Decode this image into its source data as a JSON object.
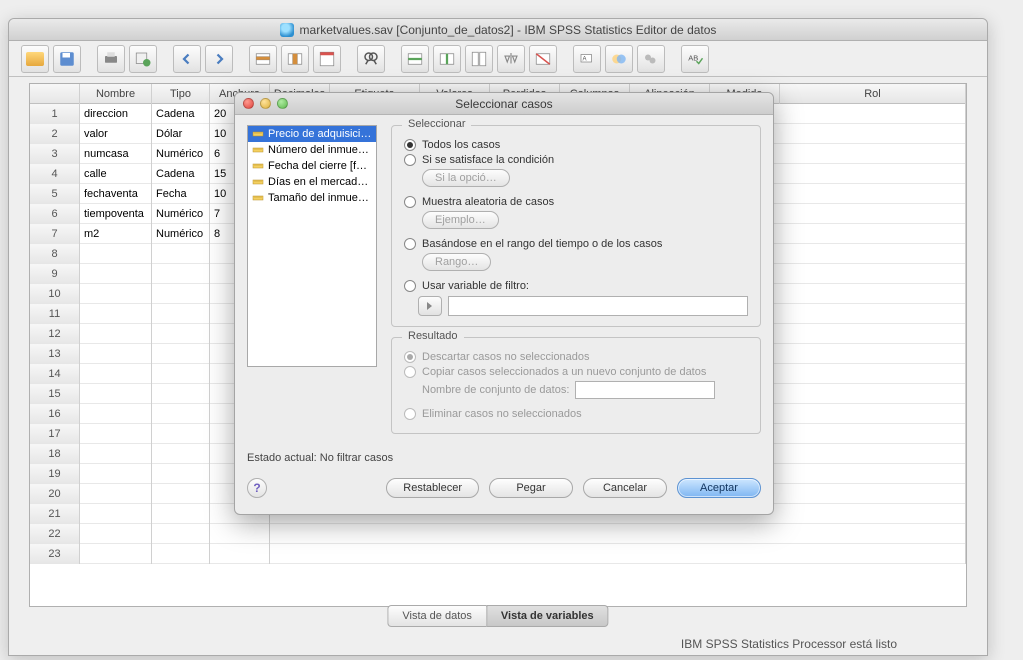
{
  "window": {
    "title": "marketvalues.sav [Conjunto_de_datos2] - IBM SPSS Statistics Editor de datos"
  },
  "grid": {
    "headers": [
      "",
      "Nombre",
      "Tipo",
      "Anchura",
      "Decimales",
      "Etiqueta",
      "Valores",
      "Perdidos",
      "Columnas",
      "Alineación",
      "Medida",
      "Rol"
    ],
    "rows": [
      {
        "n": "1",
        "name": "direccion",
        "type": "Cadena",
        "w": "20"
      },
      {
        "n": "2",
        "name": "valor",
        "type": "Dólar",
        "w": "10"
      },
      {
        "n": "3",
        "name": "numcasa",
        "type": "Numérico",
        "w": "6"
      },
      {
        "n": "4",
        "name": "calle",
        "type": "Cadena",
        "w": "15"
      },
      {
        "n": "5",
        "name": "fechaventa",
        "type": "Fecha",
        "w": "10"
      },
      {
        "n": "6",
        "name": "tiempoventa",
        "type": "Numérico",
        "w": "7"
      },
      {
        "n": "7",
        "name": "m2",
        "type": "Numérico",
        "w": "8"
      }
    ],
    "empty_rows": [
      "8",
      "9",
      "10",
      "11",
      "12",
      "13",
      "14",
      "15",
      "16",
      "17",
      "18",
      "19",
      "20",
      "21",
      "22",
      "23"
    ]
  },
  "tabs": {
    "data": "Vista de datos",
    "vars": "Vista de variables"
  },
  "status": "IBM SPSS Statistics Processor está listo",
  "dialog": {
    "title": "Seleccionar casos",
    "vars": [
      "Precio de adquisici…",
      "Número del inmue…",
      "Fecha del cierre [f…",
      "Días en el mercad…",
      "Tamaño del inmue…"
    ],
    "seleccionar": {
      "legend": "Seleccionar",
      "todos": "Todos los casos",
      "cond": "Si se satisface la condición",
      "cond_btn": "Si la opció…",
      "muestra": "Muestra aleatoria de casos",
      "muestra_btn": "Ejemplo…",
      "rango": "Basándose en el rango del tiempo o de los casos",
      "rango_btn": "Rango…",
      "filtro": "Usar variable de filtro:"
    },
    "resultado": {
      "legend": "Resultado",
      "descartar": "Descartar casos no seleccionados",
      "copiar": "Copiar casos seleccionados a un nuevo conjunto de datos",
      "nombre_ds": "Nombre de conjunto de datos:",
      "eliminar": "Eliminar casos no seleccionados"
    },
    "current": "Estado actual: No filtrar casos",
    "buttons": {
      "reset": "Restablecer",
      "paste": "Pegar",
      "cancel": "Cancelar",
      "ok": "Aceptar"
    }
  }
}
